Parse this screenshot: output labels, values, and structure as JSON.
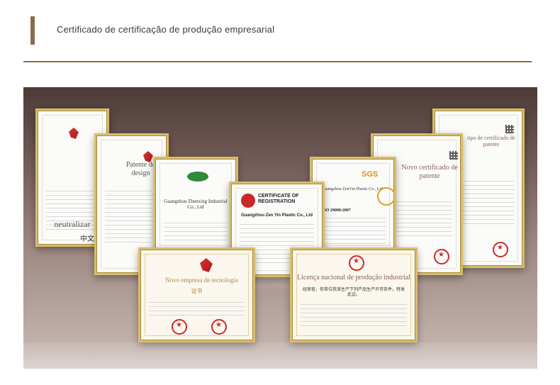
{
  "header": {
    "title": "Certificado de certificação de produção empresarial"
  },
  "certificates": {
    "c1": {
      "label": "neutralizar",
      "small": "中文"
    },
    "c2": {
      "label": "Patente de design"
    },
    "c3": {
      "label": "Guangzhou Zhenxing Industrial Co., Ltd"
    },
    "c4": {
      "label": "CERTIFICATE OF REGISTRATION",
      "company": "Guangzhou Zen Yin Plastic Co., Ltd"
    },
    "c5": {
      "label": "SGS",
      "company": "Guangzhou ZenYin Plastic Co., Ltd",
      "iso": "ISO 29000:2007"
    },
    "c6": {
      "label": "Novo certificado de patente"
    },
    "c7": {
      "label": "tipo de certificado de patente"
    },
    "c8": {
      "label": "Novo empresa de tecnologia",
      "sub": "证书"
    },
    "c9": {
      "label": "Licença nacional de produção industrial",
      "sub": "经审查，你单位获准生产下列产品生产许可条件。特发此证。"
    }
  },
  "colors": {
    "accent": "#8a6c4c",
    "frame": "#d8bd6c"
  }
}
